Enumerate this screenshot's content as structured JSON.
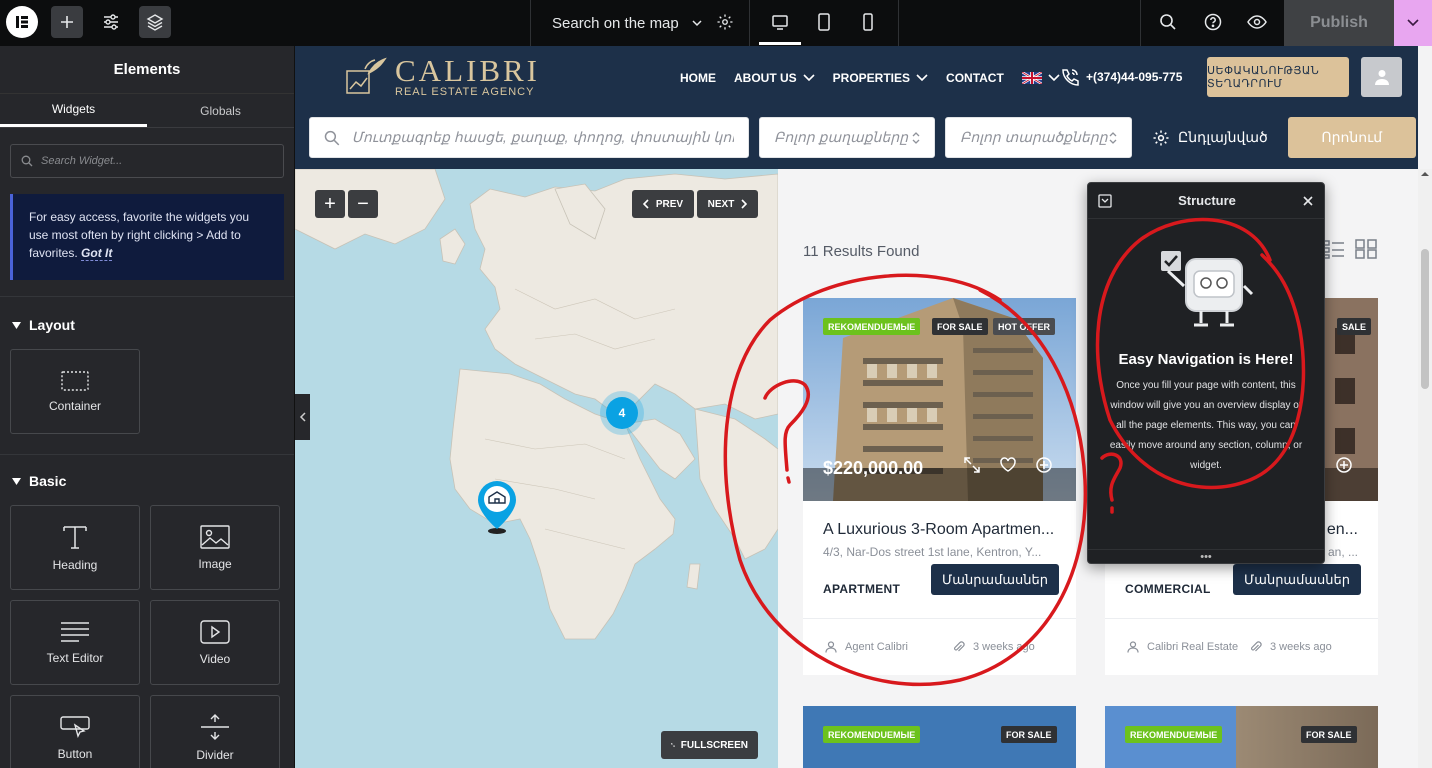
{
  "topbar": {
    "page_selector": "Search on the map",
    "publish_label": "Publish"
  },
  "panel": {
    "title": "Elements",
    "tabs": [
      "Widgets",
      "Globals"
    ],
    "search_placeholder": "Search Widget...",
    "notice_text": "For easy access, favorite the widgets you use most often by right clicking > Add to favorites.",
    "notice_link": "Got It",
    "layout_title": "Layout",
    "layout_widgets": [
      "Container"
    ],
    "basic_title": "Basic",
    "basic_widgets": [
      "Heading",
      "Image",
      "Text Editor",
      "Video",
      "Button",
      "Divider"
    ]
  },
  "site": {
    "logo_title": "CALIBRI",
    "logo_subtitle": "REAL ESTATE AGENCY",
    "nav": [
      "HOME",
      "ABOUT US",
      "PROPERTIES",
      "CONTACT"
    ],
    "phone": "+(374)44-095-775",
    "add_listing": "ՍԵՓԱԿԱՆՈՒԹՅԱՆ ՏԵՂԱԴՐՈՒՄ",
    "search_placeholder": "Մուտքագրեք հասցե, քաղաք, փողոց, փոստային կոդ",
    "city_select": "Բոլոր քաղաքները",
    "area_select": "Բոլոր տարածքները",
    "advanced": "Ընդլայնված",
    "search_button": "Որոնում"
  },
  "map": {
    "prev": "PREV",
    "next": "NEXT",
    "cluster_count": "4",
    "fullscreen": "FULLSCREEN",
    "zoom_in": "+",
    "zoom_out": "−"
  },
  "results": {
    "count_text": "11 Results Found",
    "cards": [
      {
        "badges": [
          "REKOMENDUEMЫE",
          "FOR SALE",
          "HOT OFFER"
        ],
        "price": "$220,000.00",
        "title": "A Luxurious 3-Room Apartmen...",
        "address": "4/3, Nar-Dos street 1st lane, Kentron, Y...",
        "type": "APARTMENT",
        "details": "Մանրամասներ",
        "agent": "Agent Calibri",
        "time": "3 weeks ago"
      },
      {
        "badges": [
          "SALE"
        ],
        "title": "en...",
        "address": "an, ...",
        "type": "COMMERCIAL",
        "details": "Մանրամասներ",
        "agent": "Calibri Real Estate",
        "time": "3 weeks ago"
      },
      {
        "badges": [
          "REKOMENDUEMЫE",
          "FOR SALE"
        ]
      },
      {
        "badges": [
          "REKOMENDUEMЫE",
          "FOR SALE"
        ]
      }
    ]
  },
  "structure": {
    "title": "Structure",
    "heading": "Easy Navigation is Here!",
    "body": "Once you fill your page with content, this window will give you an overview display of all the page elements. This way, you can easily move around any section, column, or widget."
  },
  "colors": {
    "site_navy": "#1d3049",
    "gold": "#dcc29a",
    "badge_green": "#6cc21d",
    "editor_dark": "#26272b",
    "annotation_red": "#d8191d",
    "cluster_blue": "#0aa2e3"
  }
}
